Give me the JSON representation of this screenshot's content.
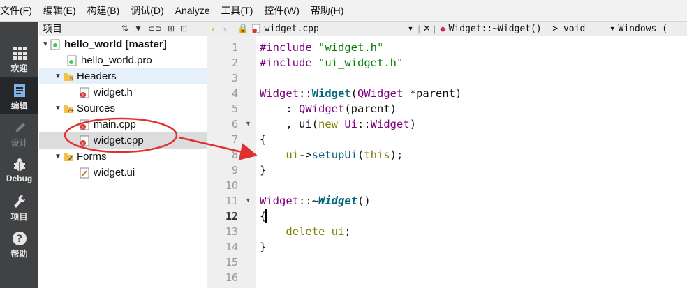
{
  "menubar": {
    "items": [
      "文件(F)",
      "编辑(E)",
      "构建(B)",
      "调试(D)",
      "Analyze",
      "工具(T)",
      "控件(W)",
      "帮助(H)"
    ]
  },
  "modebar": {
    "items": [
      {
        "label": "欢迎",
        "icon": "grid-icon"
      },
      {
        "label": "编辑",
        "icon": "document-icon"
      },
      {
        "label": "设计",
        "icon": "pencil-icon"
      },
      {
        "label": "Debug",
        "icon": "bug-icon"
      },
      {
        "label": "项目",
        "icon": "wrench-icon"
      },
      {
        "label": "帮助",
        "icon": "help-icon"
      }
    ]
  },
  "project": {
    "title": "项目",
    "tree": [
      {
        "label": "hello_world [master]",
        "icon": "project-icon"
      },
      {
        "label": "hello_world.pro",
        "icon": "pro-file-icon"
      },
      {
        "label": "Headers",
        "icon": "folder-icon"
      },
      {
        "label": "widget.h",
        "icon": "header-file-icon"
      },
      {
        "label": "Sources",
        "icon": "folder-icon"
      },
      {
        "label": "main.cpp",
        "icon": "cpp-file-icon"
      },
      {
        "label": "widget.cpp",
        "icon": "cpp-file-icon"
      },
      {
        "label": "Forms",
        "icon": "folder-icon"
      },
      {
        "label": "widget.ui",
        "icon": "ui-file-icon"
      }
    ]
  },
  "editor": {
    "file_name": "widget.cpp",
    "symbol": "Widget::~Widget() -> void",
    "encoding": "Windows (",
    "current_line": 12,
    "line_numbers": [
      "1",
      "2",
      "3",
      "4",
      "5",
      "6",
      "7",
      "8",
      "9",
      "10",
      "11",
      "12",
      "13",
      "14",
      "15",
      "16"
    ]
  },
  "colors": {
    "keyword": "#808000",
    "type": "#800080",
    "function": "#00677c",
    "string": "#008000",
    "annotation": "#e03030"
  }
}
